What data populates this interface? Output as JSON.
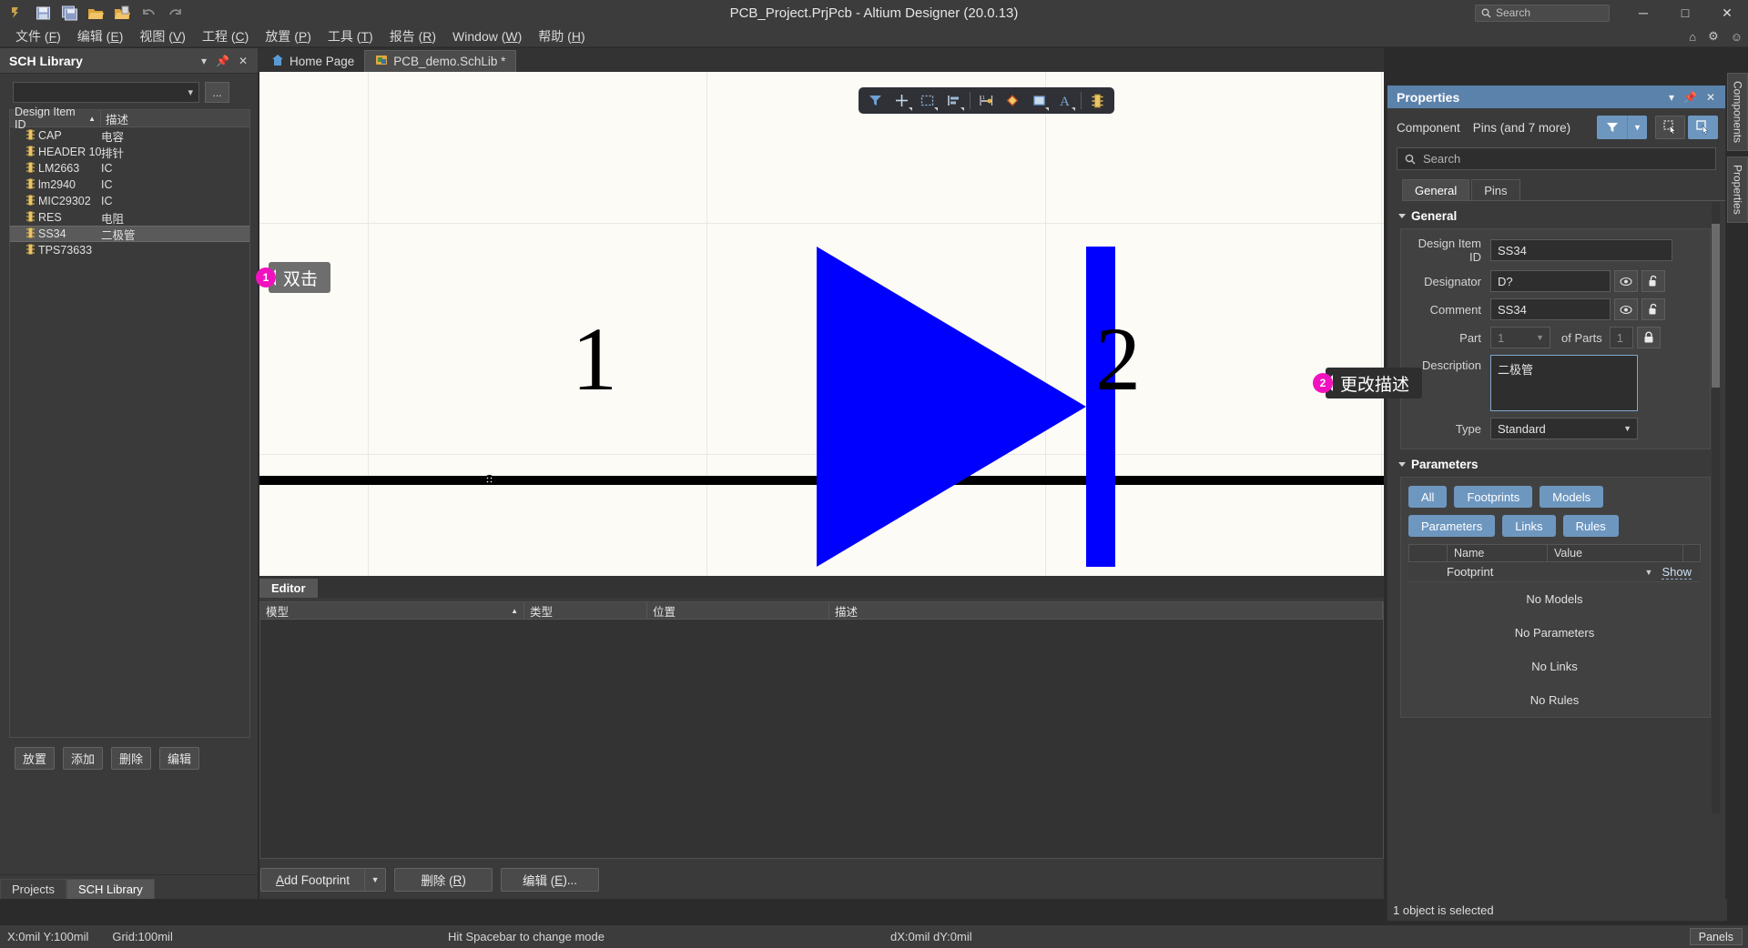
{
  "window": {
    "title": "PCB_Project.PrjPcb - Altium Designer (20.0.13)",
    "search_placeholder": "Search",
    "minimize": "─",
    "maximize": "□",
    "close": "✕",
    "quick_access": [
      "altium-logo-icon",
      "save-icon",
      "save-all-icon",
      "open-icon",
      "open-project-icon",
      "undo-icon",
      "redo-icon"
    ],
    "right_icons": [
      "home-icon",
      "gear-icon",
      "user-icon"
    ]
  },
  "menubar": {
    "items": [
      {
        "label": "文件",
        "key": "F"
      },
      {
        "label": "编辑",
        "key": "E"
      },
      {
        "label": "视图",
        "key": "V"
      },
      {
        "label": "工程",
        "key": "C"
      },
      {
        "label": "放置",
        "key": "P"
      },
      {
        "label": "工具",
        "key": "T"
      },
      {
        "label": "报告",
        "key": "R"
      },
      {
        "label": "Window",
        "key": "W"
      },
      {
        "label": "帮助",
        "key": "H"
      }
    ]
  },
  "sch_library": {
    "title": "SCH Library",
    "filter_value": "",
    "ellipsis_label": "...",
    "columns": [
      "Design Item ID",
      "描述"
    ],
    "sort_indicator": "▲",
    "rows": [
      {
        "id": "CAP",
        "desc": "电容",
        "selected": false
      },
      {
        "id": "HEADER 10",
        "desc": "排针",
        "selected": false
      },
      {
        "id": "LM2663",
        "desc": "IC",
        "selected": false
      },
      {
        "id": "lm2940",
        "desc": "IC",
        "selected": false
      },
      {
        "id": "MIC29302",
        "desc": "IC",
        "selected": false
      },
      {
        "id": "RES",
        "desc": "电阻",
        "selected": false
      },
      {
        "id": "SS34",
        "desc": "二极管",
        "selected": true
      },
      {
        "id": "TPS73633",
        "desc": "",
        "selected": false
      }
    ],
    "buttons": [
      "放置",
      "添加",
      "删除",
      "编辑"
    ],
    "tabs": [
      {
        "label": "Projects",
        "active": false
      },
      {
        "label": "SCH Library",
        "active": true
      }
    ]
  },
  "document_tabs": [
    {
      "label": "Home Page",
      "icon": "home-icon",
      "active": false
    },
    {
      "label": "PCB_demo.SchLib *",
      "icon": "schlib-icon",
      "active": true
    }
  ],
  "canvas": {
    "toolbar_icons": [
      "filter-icon",
      "crosshair-icon",
      "select-area-icon",
      "align-icon",
      "place-pin-icon",
      "place-polygon-icon",
      "place-rectangle-icon",
      "place-text-icon",
      "place-part-icon"
    ],
    "pin_numbers": [
      "1",
      "2"
    ],
    "symbol_color": "#0000ff",
    "background": "#fdfbf6"
  },
  "callouts": [
    {
      "number": "1",
      "text": "双击",
      "style": "light"
    },
    {
      "number": "2",
      "text": "更改描述",
      "style": "dark"
    }
  ],
  "editor_panel": {
    "tab_label": "Editor",
    "columns": [
      "模型",
      "类型",
      "位置",
      "描述"
    ],
    "sort_indicator": "▲",
    "rows": [],
    "buttons": [
      {
        "label": "Add Footprint",
        "accel": "A",
        "has_dropdown": true
      },
      {
        "label": "删除",
        "accel": "R",
        "has_dropdown": false
      },
      {
        "label": "编辑",
        "accel": "E",
        "suffix": "...",
        "has_dropdown": false
      }
    ]
  },
  "properties": {
    "title": "Properties",
    "object_type": "Component",
    "object_scope": "Pins (and 7 more)",
    "search_placeholder": "Search",
    "tabs": [
      {
        "label": "General",
        "active": true
      },
      {
        "label": "Pins",
        "active": false
      }
    ],
    "general_section": {
      "title": "General",
      "fields": [
        {
          "label": "Design Item ID",
          "value": "SS34",
          "type": "text"
        },
        {
          "label": "Designator",
          "value": "D?",
          "type": "text_with_icons"
        },
        {
          "label": "Comment",
          "value": "SS34",
          "type": "text_with_icons"
        },
        {
          "label": "Part",
          "value": "1",
          "type": "part",
          "of_parts_label": "of Parts",
          "of_parts_value": "1"
        },
        {
          "label": "Description",
          "value": "二极管",
          "type": "textarea"
        },
        {
          "label": "Type",
          "value": "Standard",
          "type": "select"
        }
      ]
    },
    "parameters_section": {
      "title": "Parameters",
      "filter_pills": [
        "All",
        "Footprints",
        "Models",
        "Parameters",
        "Links",
        "Rules"
      ],
      "columns": [
        "Name",
        "Value"
      ],
      "rows": [
        {
          "name": "Footprint",
          "value": "",
          "action": "Show"
        }
      ],
      "empty_messages": [
        "No Models",
        "No Parameters",
        "No Links",
        "No Rules"
      ]
    },
    "status": "1 object is selected"
  },
  "vertical_tabs": [
    "Components",
    "Properties"
  ],
  "statusbar": {
    "coords": "X:0mil Y:100mil",
    "grid": "Grid:100mil",
    "hint": "Hit Spacebar to change mode",
    "delta": "dX:0mil dY:0mil",
    "panels_label": "Panels"
  },
  "colors": {
    "accent_blue": "#5b82ab",
    "pill_blue": "#6e97c0",
    "callout_pink": "#f012be",
    "symbol_blue": "#0000ff"
  }
}
